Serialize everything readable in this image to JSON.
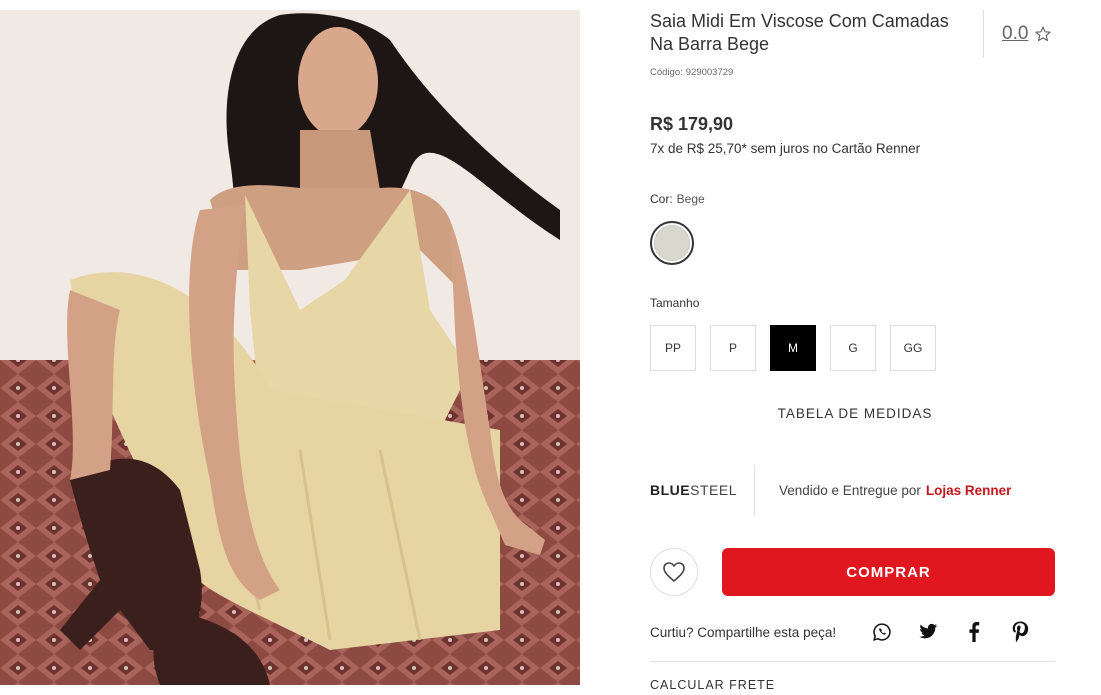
{
  "product": {
    "title": "Saia Midi Em Viscose Com Camadas Na Barra Bege",
    "rating": "0.0",
    "code_label": "Código:",
    "code_value": "929003729",
    "price": "R$ 179,90",
    "installments": "7x de R$ 25,70* sem juros no Cartão Renner",
    "image_icon": "product-photo"
  },
  "color": {
    "label": "Cor:",
    "value": "Bege",
    "swatch_hex": "#d9d8cf"
  },
  "size": {
    "label": "Tamanho",
    "options": [
      "PP",
      "P",
      "M",
      "G",
      "GG"
    ],
    "selected": "M",
    "table_link": "TABELA DE MEDIDAS"
  },
  "seller": {
    "brand_bold": "BLUE",
    "brand_light": "STEEL",
    "text": "Vendido e Entregue por",
    "name": "Lojas Renner"
  },
  "actions": {
    "buy_label": "COMPRAR",
    "favorite_icon": "heart-icon"
  },
  "share": {
    "text": "Curtiu? Compartilhe esta peça!",
    "icons": [
      "whatsapp-icon",
      "twitter-icon",
      "facebook-icon",
      "pinterest-icon"
    ]
  },
  "shipping": {
    "label": "CALCULAR FRETE"
  },
  "colors": {
    "accent": "#e0171f",
    "seller_name": "#c4161c",
    "selected_size_bg": "#000000"
  }
}
